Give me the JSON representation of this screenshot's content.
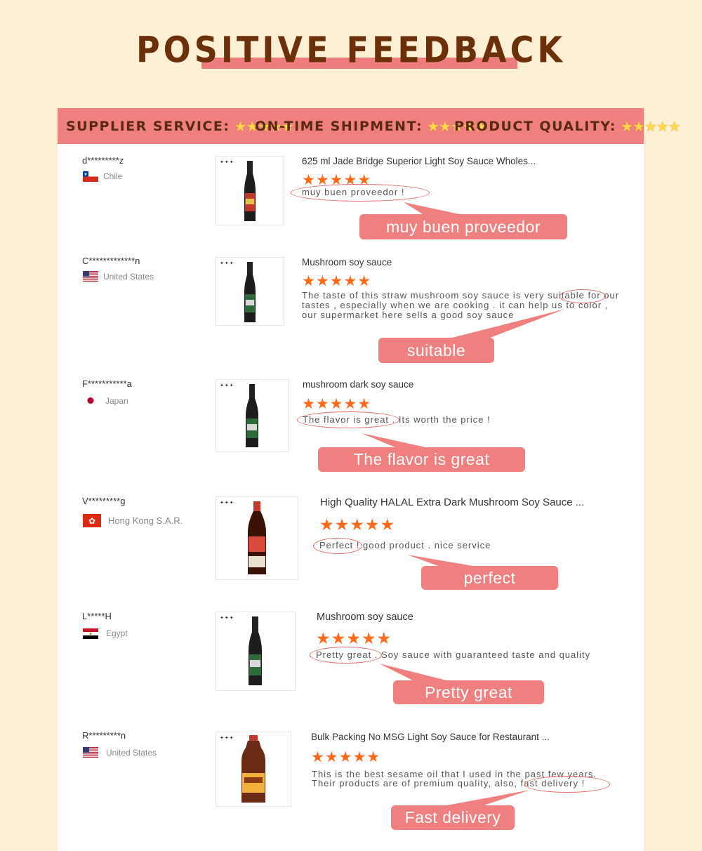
{
  "header": {
    "title": "POSITIVE FEEDBACK"
  },
  "ratings": [
    {
      "label": "SUPPLIER SERVICE:",
      "stars": "★★★★★"
    },
    {
      "label": "ON-TIME SHIPMENT:",
      "stars": "★★★★★"
    },
    {
      "label": "PRODUCT QUALITY:",
      "stars": "★★★★★"
    }
  ],
  "colors": {
    "accent": "#f08080",
    "title": "#6b2f0a",
    "background": "#fdf0d5",
    "star": "#ff6a1a"
  },
  "reviews": [
    {
      "user": "d*********z",
      "country": "Chile",
      "flag_icon": "chile-flag-icon",
      "product": "625 ml Jade Bridge Superior Light Soy Sauce Wholes...",
      "stars": "★★★★★",
      "lines": [
        "muy buen proveedor !"
      ],
      "callout": "muy buen proveedor"
    },
    {
      "user": "C*************n",
      "country": "United States",
      "flag_icon": "usa-flag-icon",
      "product": "Mushroom soy sauce",
      "stars": "★★★★★",
      "lines": [
        "The taste of this straw mushroom soy sauce is very suitable for our",
        "tastes , especially when we are cooking . it can help us to color ,",
        "our supermarket here sells a good soy sauce"
      ],
      "callout": "suitable"
    },
    {
      "user": "F***********a",
      "country": "Japan",
      "flag_icon": "japan-flag-icon",
      "product": "mushroom dark soy sauce",
      "stars": "★★★★★",
      "lines": [
        "The flavor is great . Its worth the price !"
      ],
      "callout": "The flavor is great"
    },
    {
      "user": "V*********g",
      "country": "Hong Kong S.A.R.",
      "flag_icon": "hong-kong-flag-icon",
      "product": "High Quality HALAL Extra Dark Mushroom Soy Sauce ...",
      "stars": "★★★★★",
      "lines": [
        "Perfect ! good product . nice service"
      ],
      "callout": "perfect"
    },
    {
      "user": "L*****H",
      "country": "Egypt",
      "flag_icon": "egypt-flag-icon",
      "product": "Mushroom soy sauce",
      "stars": "★★★★★",
      "lines": [
        "Pretty great . Soy sauce with guaranteed taste and quality"
      ],
      "callout": "Pretty great"
    },
    {
      "user": "R*********n",
      "country": "United States",
      "flag_icon": "usa-flag-icon",
      "product": "Bulk Packing No MSG Light Soy Sauce for Restaurant ...",
      "stars": "★★★★★",
      "lines": [
        "This is the best sesame oil that I used in the past few years.",
        "Their products are of premium quality, also, fast delivery !"
      ],
      "callout": "Fast delivery"
    }
  ]
}
